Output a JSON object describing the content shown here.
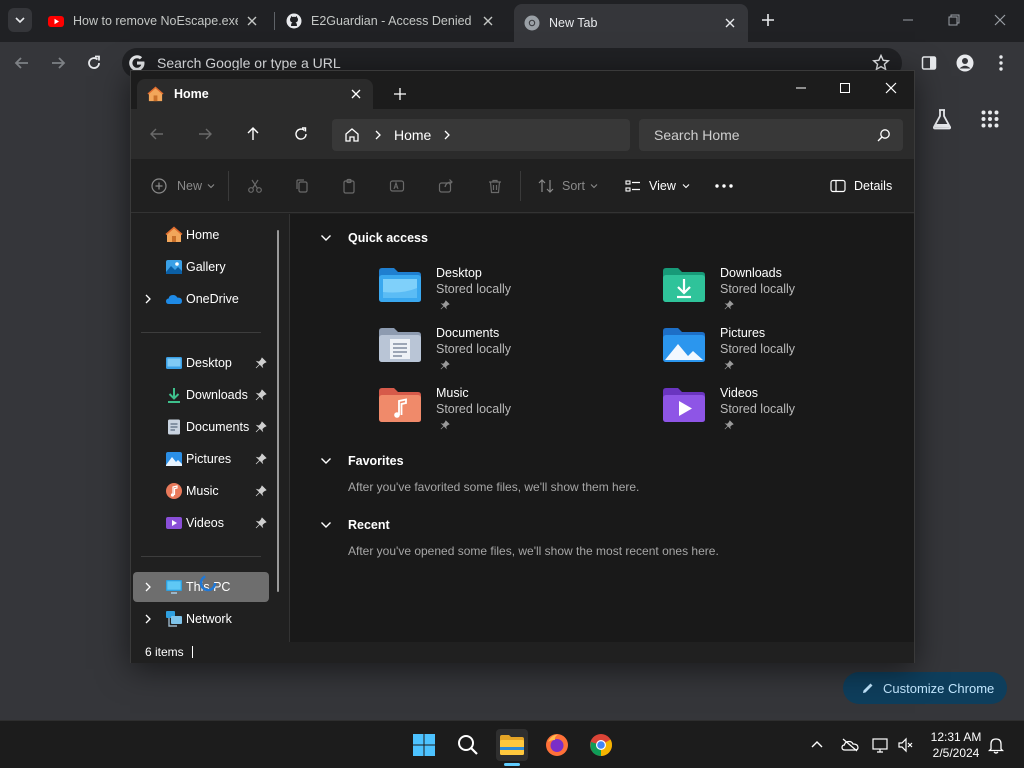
{
  "chrome": {
    "tabs": [
      {
        "title": "How to remove NoEscape.exe |",
        "icon": "youtube-icon"
      },
      {
        "title": "E2Guardian - Access Denied",
        "icon": "github-icon"
      },
      {
        "title": "New Tab",
        "icon": "chrome-icon",
        "active": true
      }
    ],
    "omnibox_placeholder": "Search Google or type a URL",
    "customize_label": "Customize Chrome"
  },
  "explorer": {
    "tab_title": "Home",
    "breadcrumb": [
      "Home"
    ],
    "search_placeholder": "Search Home",
    "commands": {
      "new": "New",
      "sort": "Sort",
      "view": "View",
      "details": "Details"
    },
    "nav": {
      "top": [
        {
          "label": "Home",
          "icon": "home-icon"
        },
        {
          "label": "Gallery",
          "icon": "gallery-icon"
        },
        {
          "label": "OneDrive",
          "icon": "cloud-icon"
        }
      ],
      "pinned": [
        {
          "label": "Desktop",
          "icon": "desktop-folder-icon"
        },
        {
          "label": "Downloads",
          "icon": "download-icon"
        },
        {
          "label": "Documents",
          "icon": "documents-icon"
        },
        {
          "label": "Pictures",
          "icon": "pictures-icon"
        },
        {
          "label": "Music",
          "icon": "music-icon"
        },
        {
          "label": "Videos",
          "icon": "videos-icon"
        }
      ],
      "bottom": [
        {
          "label": "This PC",
          "icon": "computer-icon",
          "selected": true
        },
        {
          "label": "Network",
          "icon": "network-icon"
        }
      ]
    },
    "sections": {
      "quick_access": "Quick access",
      "favorites": "Favorites",
      "favorites_note": "After you've favorited some files, we'll show them here.",
      "recent": "Recent",
      "recent_note": "After you've opened some files, we'll show the most recent ones here."
    },
    "quick_access_items": [
      {
        "name": "Desktop",
        "status": "Stored locally"
      },
      {
        "name": "Downloads",
        "status": "Stored locally"
      },
      {
        "name": "Documents",
        "status": "Stored locally"
      },
      {
        "name": "Pictures",
        "status": "Stored locally"
      },
      {
        "name": "Music",
        "status": "Stored locally"
      },
      {
        "name": "Videos",
        "status": "Stored locally"
      }
    ],
    "status_count": "6 items"
  },
  "taskbar": {
    "time": "12:31 AM",
    "date": "2/5/2024"
  },
  "colors": {
    "accent": "#60cdff",
    "explorer_bg": "#191919",
    "chrome_bg": "#35363a"
  }
}
